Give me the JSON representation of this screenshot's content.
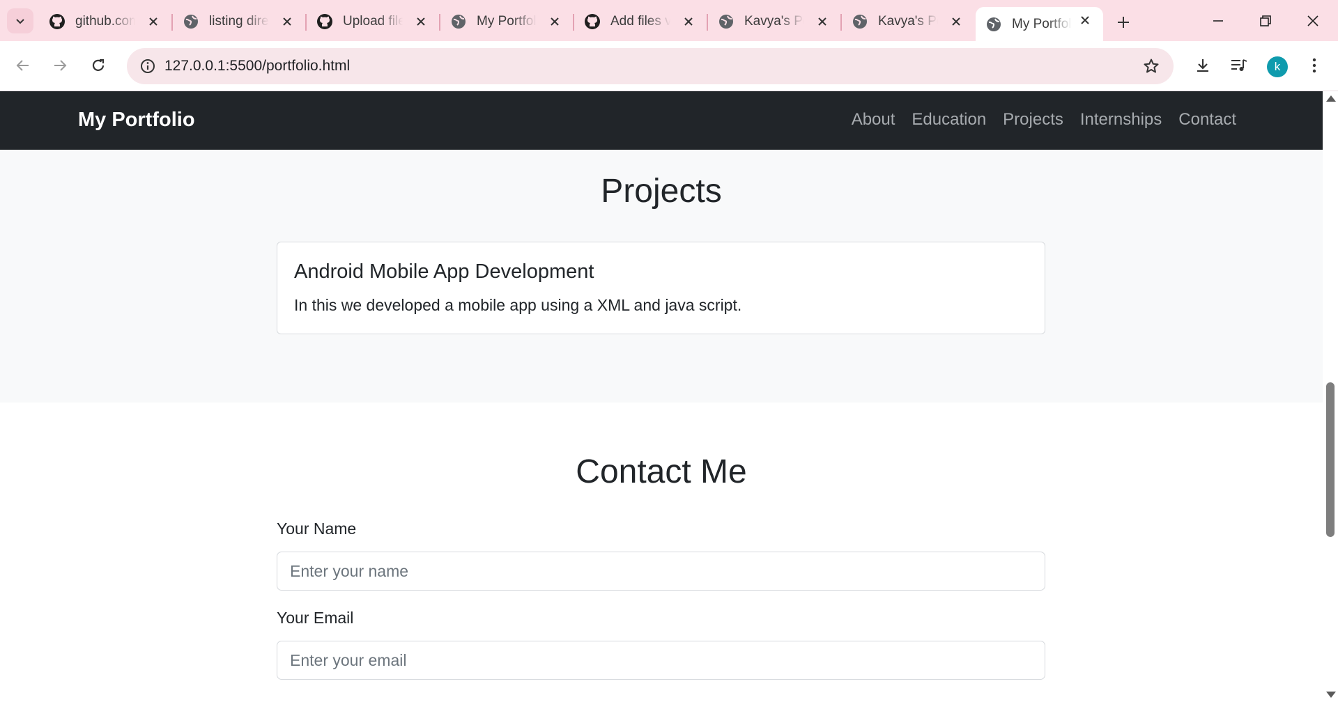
{
  "browser": {
    "tabs": [
      {
        "title": "github.com",
        "icon": "github-icon"
      },
      {
        "title": "listing directory",
        "icon": "globe-icon"
      },
      {
        "title": "Upload files",
        "icon": "github-icon"
      },
      {
        "title": "My Portfolio",
        "icon": "globe-icon"
      },
      {
        "title": "Add files via upload",
        "icon": "github-icon"
      },
      {
        "title": "Kavya's Portfolio",
        "icon": "globe-icon"
      },
      {
        "title": "Kavya's Portfolio",
        "icon": "globe-icon"
      },
      {
        "title": "My Portfolio",
        "icon": "globe-icon",
        "active": true
      }
    ],
    "url": "127.0.0.1:5500/portfolio.html",
    "profile_initial": "k",
    "colors": {
      "tabstrip": "#fbdfe6",
      "omnibox": "#f7e6ea",
      "avatar": "#0f9bad"
    }
  },
  "page": {
    "navbar": {
      "brand": "My Portfolio",
      "links": [
        "About",
        "Education",
        "Projects",
        "Internships",
        "Contact"
      ]
    },
    "projects": {
      "heading": "Projects",
      "cards": [
        {
          "title": "Android Mobile App Development",
          "text": "In this we developed a mobile app using a XML and java script."
        }
      ]
    },
    "contact": {
      "heading": "Contact Me",
      "name_label": "Your Name",
      "name_placeholder": "Enter your name",
      "name_value": "",
      "email_label": "Your Email",
      "email_placeholder": "Enter your email",
      "email_value": ""
    }
  }
}
